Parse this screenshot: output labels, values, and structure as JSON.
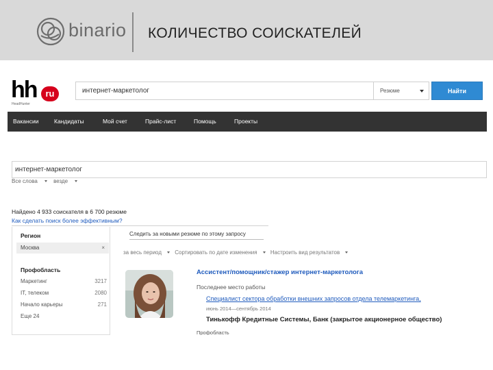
{
  "slide": {
    "brand": "binario",
    "title": "КОЛИЧЕСТВО СОИСКАТЕЛЕЙ"
  },
  "hh": {
    "logo_letters": "hh",
    "logo_badge": "ru",
    "logo_sub": "HeadHunter",
    "search_value": "интернет-маркетолог",
    "search_scope": "Резюме",
    "search_button": "Найти",
    "nav": [
      "Вакансии",
      "Кандидаты",
      "Мой счет",
      "Прайс-лист",
      "Помощь",
      "Проекты"
    ]
  },
  "query": {
    "value": "интернет-маркетолог",
    "filter_words": "Все слова",
    "filter_where": "везде"
  },
  "results": {
    "found_text": "Найдено 4 933 соискателя в 6 700 резюме",
    "improve_link": "Как сделать поиск более эффективным?",
    "follow_text": "Следить за новыми резюме по этому запросу",
    "sort": [
      "за весь период",
      "Сортировать по дате изменения",
      "Настроить вид результатов"
    ]
  },
  "sidebar": {
    "region_title": "Регион",
    "region_value": "Москва",
    "prof_title": "Профобласть",
    "items": [
      {
        "label": "Маркетинг",
        "count": "3217"
      },
      {
        "label": "IT, телеком",
        "count": "2080"
      },
      {
        "label": "Начало карьеры",
        "count": "271"
      }
    ],
    "more": "Еще 24"
  },
  "resume": {
    "title": "Ассистент/помощник/стажер интернет-маркетолога",
    "last_place_label": "Последнее место работы",
    "position": "Специалист сектора обработки внешних запросов отдела телемаркетинга,",
    "dates": "июнь 2014—сентябрь 2014",
    "company": "Тинькофф Кредитные Системы, Банк (закрытое акционерное общество)",
    "next_label": "Профобласть"
  },
  "colors": {
    "header_bg": "#d9d9d9",
    "nav_bg": "#333333",
    "hh_red": "#d6001c",
    "button_blue": "#2f8ad3",
    "link_blue": "#1f5bbd"
  }
}
